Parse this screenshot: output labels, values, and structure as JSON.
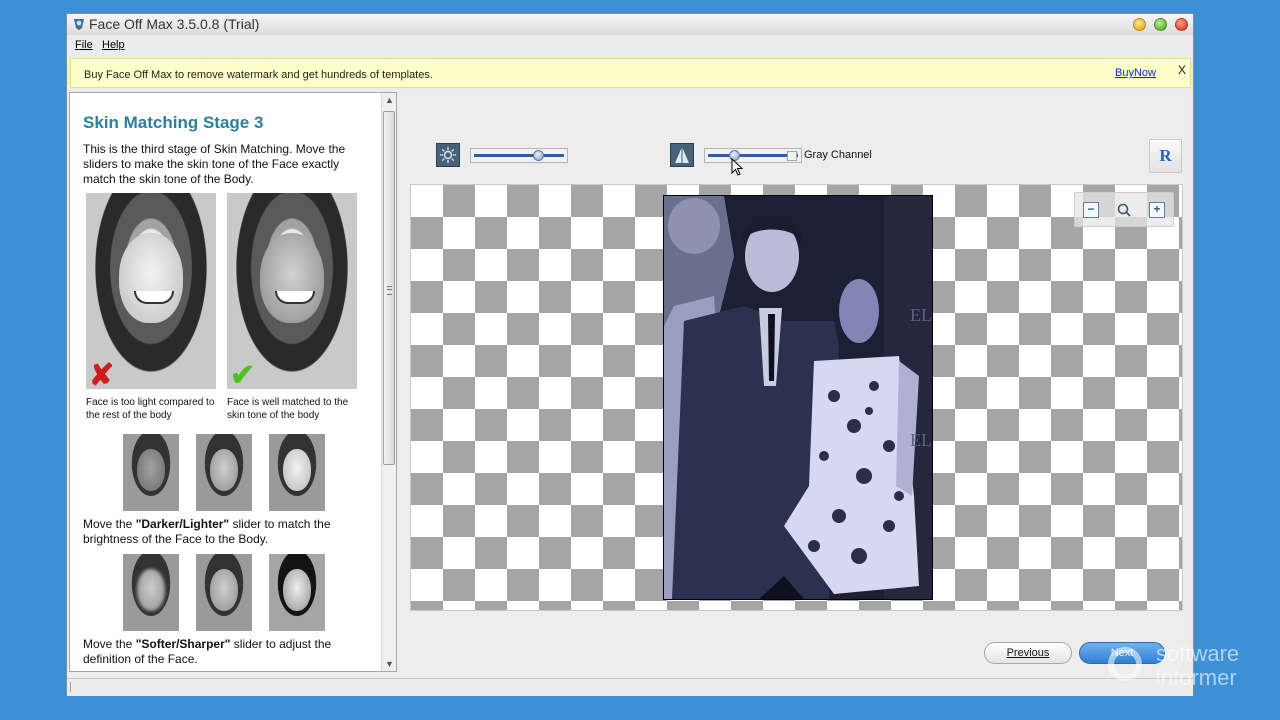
{
  "window": {
    "title": "Face Off Max  3.5.0.8  (Trial)"
  },
  "menu": {
    "file_label": "File",
    "help_label": "Help"
  },
  "promo": {
    "text": "Buy Face Off Max to remove watermark and get hundreds of templates.",
    "link_label": "BuyNow",
    "close_label": "X"
  },
  "sidebar": {
    "heading": "Skin Matching Stage 3",
    "intro": "This is the third stage of Skin Matching. Move the sliders to make the skin tone of the Face exactly match the skin tone of the Body.",
    "example_bad_caption": "Face is too light compared to the rest of the body",
    "example_good_caption": "Face is well matched to the skin tone of the body",
    "darker_text_pre": "Move the ",
    "darker_text_bold": "\"Darker/Lighter\"",
    "darker_text_post": " slider to match the brightness of the Face to the Body.",
    "softer_text_pre": "Move the ",
    "softer_text_bold": "\"Softer/Sharper\"",
    "softer_text_post": " slider to adjust the definition of the Face."
  },
  "toolbar": {
    "brightness_icon": "brightness-icon",
    "sharpness_icon": "sharpness-icon",
    "brightness_level": 0.72,
    "sharpness_level": 0.27,
    "gray_channel_label": "Gray Channel",
    "gray_channel_checked": false,
    "reset_label": "R"
  },
  "zoom": {
    "zoom_out_label": "−",
    "zoom_fit_icon": "magnifier-icon",
    "zoom_in_label": "+"
  },
  "navigation": {
    "previous_label": "Previous",
    "next_label": "Next"
  },
  "watermark": {
    "line1": "software",
    "line2": "informer"
  },
  "colors": {
    "desktop": "#3d8fd6",
    "heading": "#2c7f9d",
    "promo_bg": "#ffffc9",
    "link": "#0033cc"
  }
}
